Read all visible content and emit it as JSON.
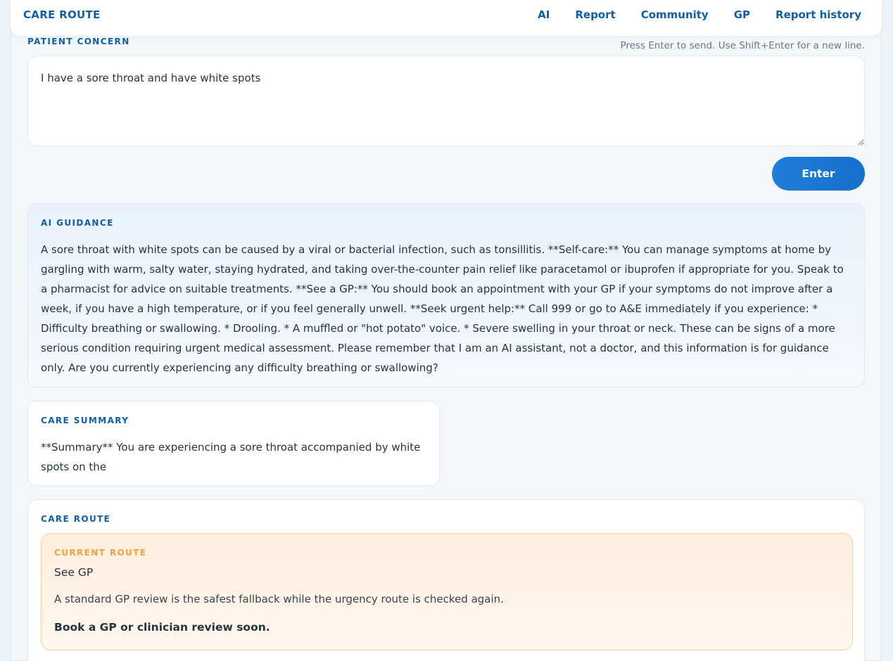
{
  "nav": {
    "brand": "CARE ROUTE",
    "links": [
      "AI",
      "Report",
      "Community",
      "GP",
      "Report history"
    ]
  },
  "concern": {
    "label": "PATIENT CONCERN",
    "hint": "Press Enter to send. Use Shift+Enter for a new line.",
    "value": "I have a sore throat and have white spots",
    "submit_label": "Enter"
  },
  "guidance": {
    "label": "AI GUIDANCE",
    "text": "A sore throat with white spots can be caused by a viral or bacterial infection, such as tonsillitis. **Self-care:** You can manage symptoms at home by gargling with warm, salty water, staying hydrated, and taking over-the-counter pain relief like paracetamol or ibuprofen if appropriate for you. Speak to a pharmacist for advice on suitable treatments. **See a GP:** You should book an appointment with your GP if your symptoms do not improve after a week, if you have a high temperature, or if you feel generally unwell. **Seek urgent help:** Call 999 or go to A&E immediately if you experience: * Difficulty breathing or swallowing. * Drooling. * A muffled or \"hot potato\" voice. * Severe swelling in your throat or neck. These can be signs of a more serious condition requiring urgent medical assessment. Please remember that I am an AI assistant, not a doctor, and this information is for guidance only. Are you currently experiencing any difficulty breathing or swallowing?"
  },
  "summary": {
    "label": "CARE SUMMARY",
    "text": "**Summary** You are experiencing a sore throat accompanied by white spots on the"
  },
  "route": {
    "label": "CARE ROUTE",
    "current_label": "CURRENT ROUTE",
    "name": "See GP",
    "reason": "A standard GP review is the safest fallback while the urgency route is checked again.",
    "action": "Book a GP or clinician review soon."
  }
}
